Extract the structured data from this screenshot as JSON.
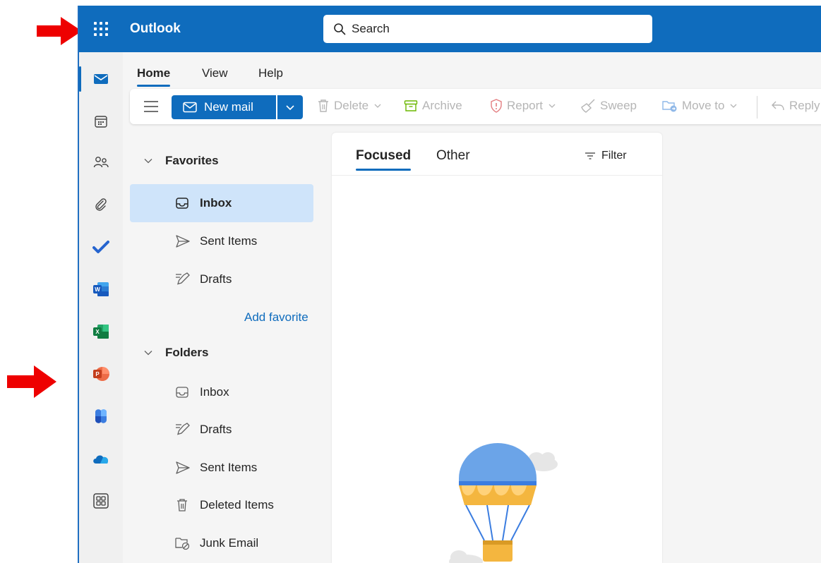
{
  "topbar": {
    "app_title": "Outlook",
    "search_placeholder": "Search",
    "brand_color": "#0f6cbd"
  },
  "rail": {
    "items": [
      {
        "name": "mail",
        "icon": "mail-icon",
        "active": true
      },
      {
        "name": "calendar",
        "icon": "calendar-icon"
      },
      {
        "name": "people",
        "icon": "people-icon"
      },
      {
        "name": "files",
        "icon": "paperclip-icon"
      },
      {
        "name": "to-do",
        "icon": "todo-check-icon"
      },
      {
        "name": "word",
        "icon": "word-icon"
      },
      {
        "name": "excel",
        "icon": "excel-icon"
      },
      {
        "name": "powerpoint",
        "icon": "powerpoint-icon"
      },
      {
        "name": "microsoft-365",
        "icon": "m365-icon"
      },
      {
        "name": "onedrive",
        "icon": "onedrive-icon"
      },
      {
        "name": "more-apps",
        "icon": "more-apps-icon"
      }
    ]
  },
  "ribbon": {
    "tabs": [
      {
        "label": "Home",
        "active": true
      },
      {
        "label": "View"
      },
      {
        "label": "Help"
      }
    ]
  },
  "toolbar": {
    "new_mail_label": "New mail",
    "delete_label": "Delete",
    "archive_label": "Archive",
    "report_label": "Report",
    "sweep_label": "Sweep",
    "move_to_label": "Move to",
    "reply_label": "Reply"
  },
  "favorites": {
    "header": "Favorites",
    "items": [
      {
        "label": "Inbox",
        "icon": "inbox-icon",
        "selected": true
      },
      {
        "label": "Sent Items",
        "icon": "send-icon"
      },
      {
        "label": "Drafts",
        "icon": "drafts-icon"
      }
    ],
    "add_favorite_label": "Add favorite"
  },
  "folders": {
    "header": "Folders",
    "items": [
      {
        "label": "Inbox",
        "icon": "inbox-icon"
      },
      {
        "label": "Drafts",
        "icon": "drafts-icon"
      },
      {
        "label": "Sent Items",
        "icon": "send-icon"
      },
      {
        "label": "Deleted Items",
        "icon": "trash-icon"
      },
      {
        "label": "Junk Email",
        "icon": "junk-folder-icon"
      }
    ]
  },
  "message_list": {
    "tabs": [
      {
        "label": "Focused",
        "active": true
      },
      {
        "label": "Other"
      }
    ],
    "filter_label": "Filter"
  },
  "annotations": {
    "arrow_color": "#ee0000"
  }
}
